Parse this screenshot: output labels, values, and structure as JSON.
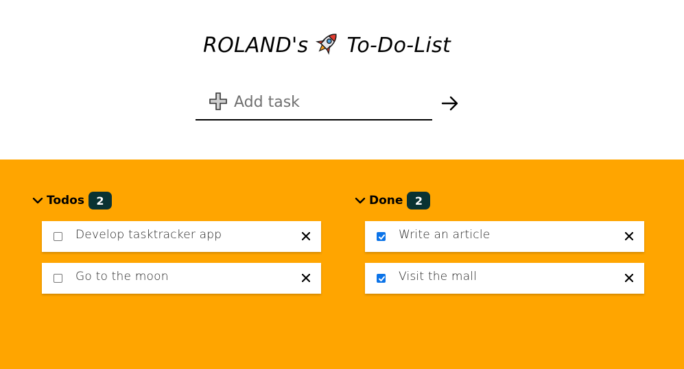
{
  "header": {
    "title_before": "ROLAND's",
    "title_after": "To-Do-List",
    "rocket_icon": "rocket-icon"
  },
  "add_task": {
    "placeholder": "Add task",
    "plus_icon": "plus-icon",
    "submit_icon": "arrow-right-icon"
  },
  "colors": {
    "board_background": "#ffa500",
    "badge_background": "#0a3232",
    "checkbox_checked": "#0b73e8"
  },
  "sections": {
    "todos": {
      "title": "Todos",
      "count": "2",
      "items": [
        {
          "label": "Develop tasktracker app",
          "checked": false
        },
        {
          "label": "Go to the moon",
          "checked": false
        }
      ]
    },
    "done": {
      "title": "Done",
      "count": "2",
      "items": [
        {
          "label": "Write an article",
          "checked": true
        },
        {
          "label": "Visit the mall",
          "checked": true
        }
      ]
    }
  }
}
